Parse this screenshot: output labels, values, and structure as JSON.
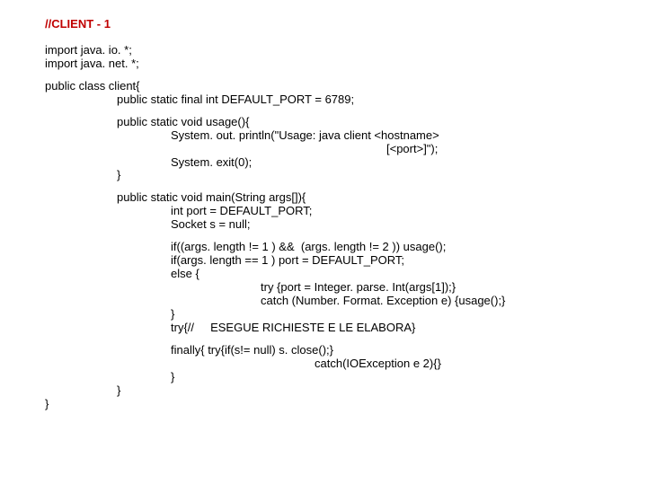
{
  "title": "//CLIENT - 1",
  "imports": [
    "import java. io. *;",
    "import java. net. *;"
  ],
  "class_decl": "public class client{",
  "field": "public static final int DEFAULT_PORT = 6789;",
  "usage": {
    "sig": "public static void usage(){",
    "l1": "System. out. println(\"Usage: java client <hostname>",
    "l2": "[<port>]\");",
    "l3": "System. exit(0);",
    "close": "}"
  },
  "main": {
    "sig": "public static void main(String args[]){",
    "v1": "int port = DEFAULT_PORT;",
    "v2": "Socket s = null;",
    "c1": "if((args. length != 1 ) &&  (args. length != 2 )) usage();",
    "c2": "if(args. length == 1 ) port = DEFAULT_PORT;",
    "c3": "else {",
    "c4": "try {port = Integer. parse. Int(args[1]);}",
    "c5": "catch (Number. Format. Exception e) {usage();}",
    "c6": "}",
    "c7": "try{//     ESEGUE RICHIESTE E LE ELABORA}",
    "f1": "finally{ try{if(s!= null) s. close();}",
    "f2": "catch(IOException e 2){}",
    "f3": "}",
    "close_main": "}",
    "close_class": "}"
  }
}
